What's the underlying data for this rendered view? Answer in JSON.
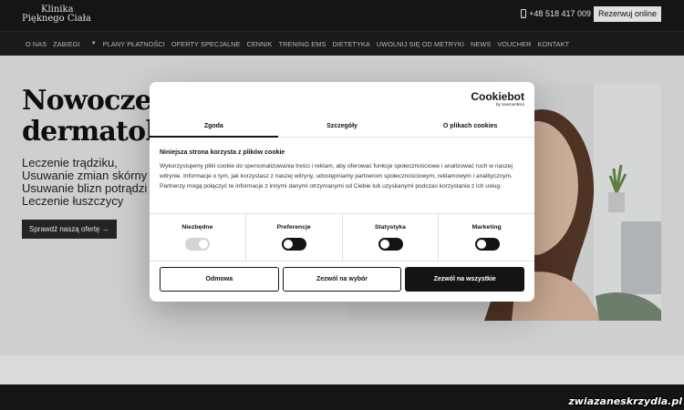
{
  "header": {
    "logo_line1": "Klinika",
    "logo_line2": "Pięknego Ciała",
    "phone": "+48 518 417 009",
    "reserve_label": "Rezerwuj online"
  },
  "nav": {
    "items": [
      "O NAS",
      "ZABIEGI",
      "PLANY PŁATNOŚCI",
      "OFERTY SPECJALNE",
      "CENNIK",
      "TRENING EMS",
      "DIETETYKA",
      "UWOLNIJ SIĘ OD METRYKI",
      "NEWS",
      "VOUCHER",
      "KONTAKT"
    ]
  },
  "hero": {
    "headline_line1": "Nowoczesn",
    "headline_line2": "dermatolog",
    "services": [
      "Leczenie trądziku,",
      "Usuwanie zmian skórny",
      "Usuwanie blizn potrądzi",
      "Leczenie łuszczycy"
    ],
    "cta_label": "Sprawdź naszą ofertę"
  },
  "cookie_dialog": {
    "brand": "Cookiebot",
    "brand_sub": "by Usercentrics",
    "tabs": [
      "Zgoda",
      "Szczegóły",
      "O plikach cookies"
    ],
    "title": "Niniejsza strona korzysta z plików cookie",
    "text": "Wykorzystujemy pliki cookie do spersonalizowania treści i reklam, aby oferować funkcje społecznościowe i analizować ruch w naszej witrynie. Informacje o tym, jak korzystasz z naszej witryny, udostępniamy partnerom społecznościowym, reklamowym i analitycznym. Partnerzy mogą połączyć te informacje z innymi danymi otrzymanymi od Ciebie lub uzyskanymi podczas korzystania z ich usług.",
    "toggles": [
      {
        "label": "Niezbędne",
        "state": "on",
        "disabled": true
      },
      {
        "label": "Preferencje",
        "state": "on",
        "disabled": false
      },
      {
        "label": "Statystyka",
        "state": "on",
        "disabled": false
      },
      {
        "label": "Marketing",
        "state": "on",
        "disabled": false
      }
    ],
    "buttons": {
      "deny": "Odmowa",
      "allow_selection": "Zezwól na wybór",
      "allow_all": "Zezwól na wszystkie"
    }
  },
  "watermark": "zwiazaneskrzydla.pl",
  "colors": {
    "dark": "#181818",
    "accent": "#141414"
  }
}
